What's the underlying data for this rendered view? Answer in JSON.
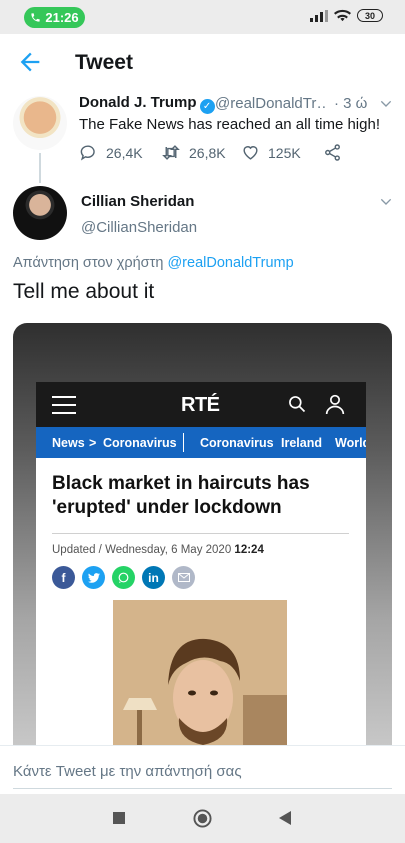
{
  "status_bar": {
    "call_time": "21:26",
    "battery": "30"
  },
  "header": {
    "title": "Tweet"
  },
  "parent_tweet": {
    "name": "Donald J. Trump",
    "handle": "@realDonaldTr…",
    "time": "· 3 ώ",
    "text": "The Fake News has reached an all time high!",
    "replies": "26,4K",
    "retweets": "26,8K",
    "likes": "125K"
  },
  "reply_tweet": {
    "name": "Cillian Sheridan",
    "handle": "@CillianSheridan",
    "reply_prefix": "Απάντηση στον χρήστη",
    "reply_mention": "@realDonaldTrump",
    "text": "Tell me about it"
  },
  "article": {
    "logo": "RTÉ",
    "nav": [
      "News",
      ">",
      "Coronavirus",
      "Coronavirus",
      "Ireland",
      "World"
    ],
    "headline": "Black market in haircuts has 'erupted' under lockdown",
    "updated_prefix": "Updated / Wednesday, 6 May 2020",
    "updated_time": "12:24",
    "share_icons": [
      "facebook-icon",
      "twitter-icon",
      "whatsapp-icon",
      "linkedin-icon",
      "email-icon"
    ]
  },
  "composer": {
    "placeholder": "Κάντε Tweet με την απάντησή σας"
  },
  "colors": {
    "twitter_blue": "#1da1f2",
    "rte_blue": "#1565c0",
    "call_green": "#35c759"
  }
}
